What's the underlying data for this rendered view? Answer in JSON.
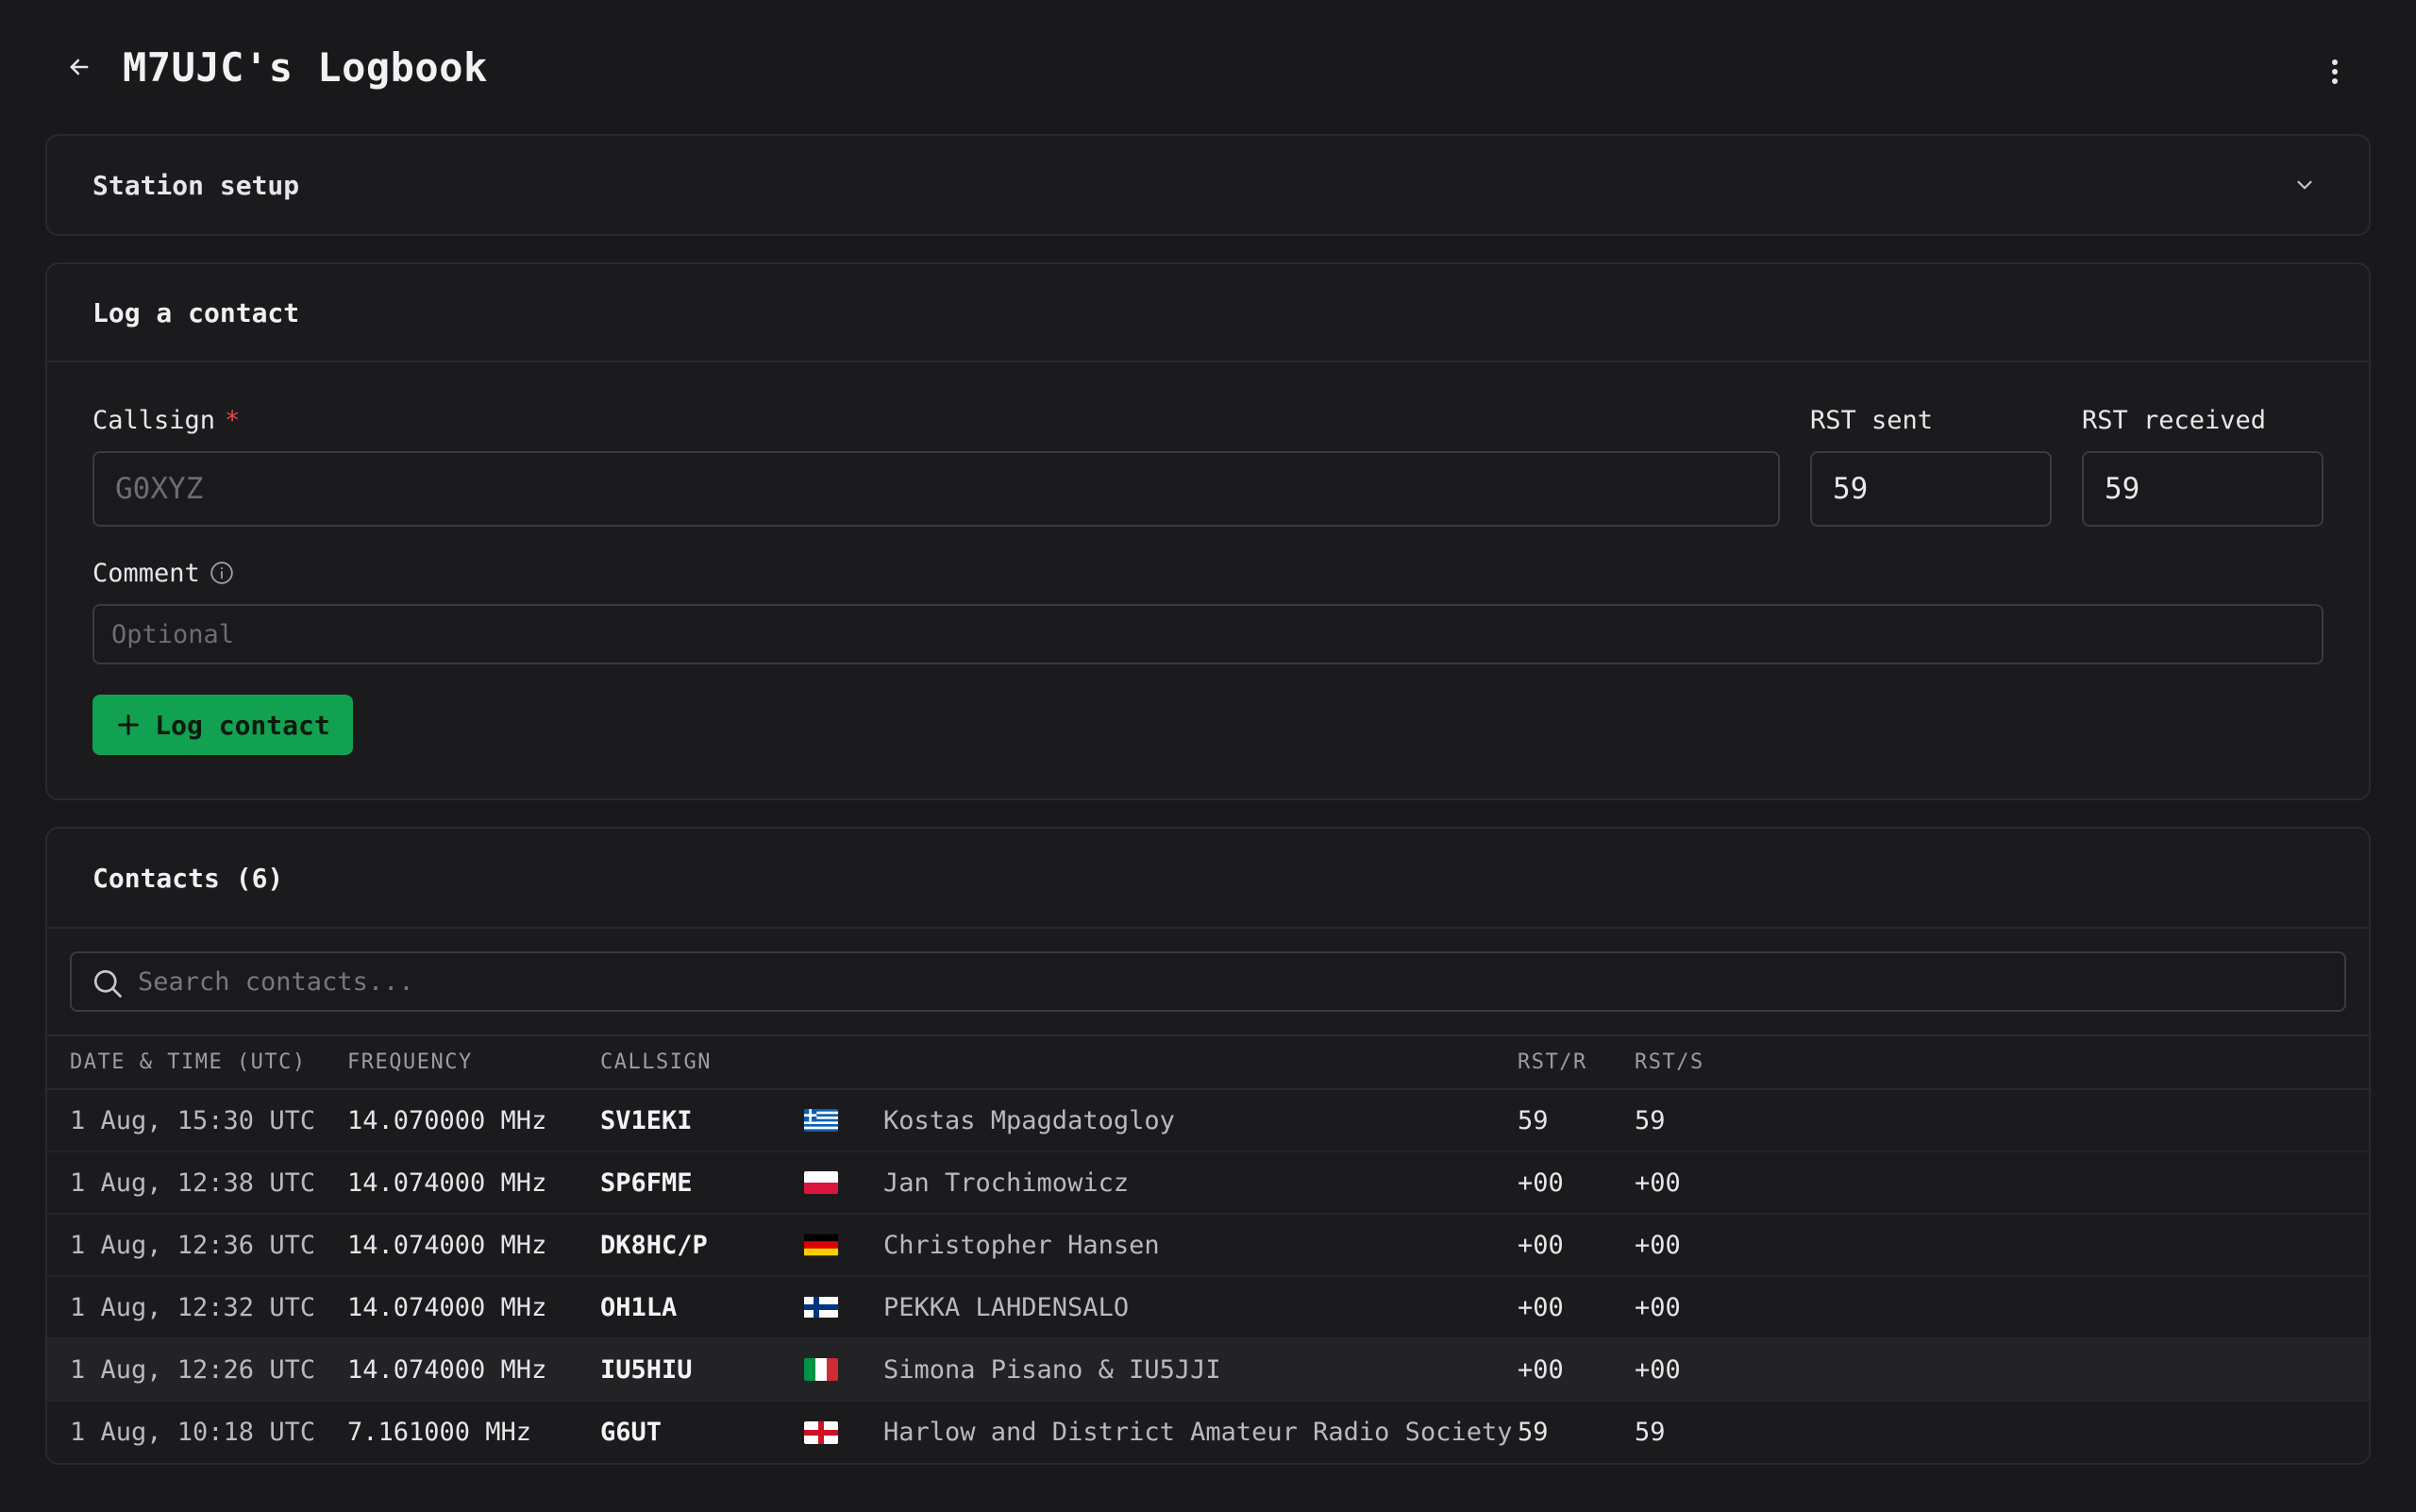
{
  "header": {
    "title": "M7UJC's Logbook"
  },
  "station": {
    "title": "Station setup"
  },
  "log": {
    "title": "Log a contact",
    "callsign_label": "Callsign",
    "required_mark": "*",
    "callsign_placeholder": "G0XYZ",
    "rst_sent_label": "RST sent",
    "rst_sent_value": "59",
    "rst_received_label": "RST received",
    "rst_received_value": "59",
    "comment_label": "Comment",
    "comment_placeholder": "Optional",
    "submit_label": "Log contact"
  },
  "contacts": {
    "title": "Contacts (6)",
    "search_placeholder": "Search contacts...",
    "columns": {
      "date": "DATE & TIME (UTC)",
      "freq": "FREQUENCY",
      "call": "CALLSIGN",
      "rstr": "RST/R",
      "rsts": "RST/S"
    },
    "rows": [
      {
        "date": "1 Aug, 15:30 UTC",
        "freq": "14.070000 MHz",
        "call": "SV1EKI",
        "flag": "greece-flag-icon",
        "name": "Kostas Mpagdatogloy",
        "rstr": "59",
        "rsts": "59"
      },
      {
        "date": "1 Aug, 12:38 UTC",
        "freq": "14.074000 MHz",
        "call": "SP6FME",
        "flag": "poland-flag-icon",
        "name": "Jan Trochimowicz",
        "rstr": "+00",
        "rsts": "+00"
      },
      {
        "date": "1 Aug, 12:36 UTC",
        "freq": "14.074000 MHz",
        "call": "DK8HC/P",
        "flag": "germany-flag-icon",
        "name": "Christopher Hansen",
        "rstr": "+00",
        "rsts": "+00"
      },
      {
        "date": "1 Aug, 12:32 UTC",
        "freq": "14.074000 MHz",
        "call": "OH1LA",
        "flag": "finland-flag-icon",
        "name": "PEKKA LAHDENSALO",
        "rstr": "+00",
        "rsts": "+00"
      },
      {
        "date": "1 Aug, 12:26 UTC",
        "freq": "14.074000 MHz",
        "call": "IU5HIU",
        "flag": "italy-flag-icon",
        "name": "Simona Pisano & IU5JJI",
        "rstr": "+00",
        "rsts": "+00"
      },
      {
        "date": "1 Aug, 10:18 UTC",
        "freq": "7.161000 MHz",
        "call": "G6UT",
        "flag": "england-flag-icon",
        "name": "Harlow and District Amateur Radio Society",
        "rstr": "59",
        "rsts": "59"
      }
    ]
  },
  "colors": {
    "accent": "#12a150",
    "background": "#19191b",
    "required": "#e5484d"
  }
}
